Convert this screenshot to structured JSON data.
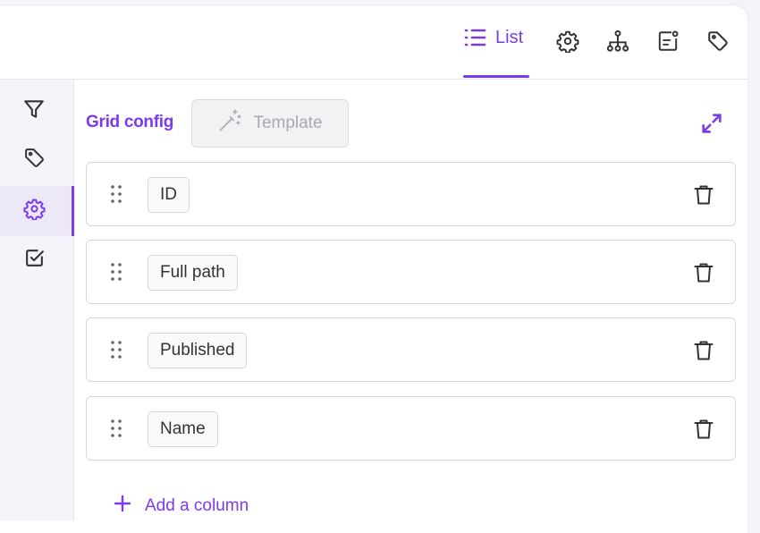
{
  "colors": {
    "accent": "#7c3aed",
    "page_background": "#f4f3f8",
    "icon": "#333333"
  },
  "toolbar": {
    "active_tab": {
      "label": "List",
      "icon": "list-icon"
    },
    "icons": [
      "gear-icon",
      "hierarchy-icon",
      "document-settings-icon",
      "tag-icon"
    ]
  },
  "sidebar": {
    "items": [
      {
        "icon": "filter-icon",
        "active": false
      },
      {
        "icon": "tag-icon",
        "active": false
      },
      {
        "icon": "gear-icon",
        "active": true
      },
      {
        "icon": "checkbox-icon",
        "active": false
      }
    ]
  },
  "main": {
    "title": "Grid config",
    "template_button": {
      "label": "Template",
      "icon": "magic-wand-icon",
      "disabled": true
    },
    "expand_icon": "expand-icon",
    "columns": [
      {
        "label": "ID"
      },
      {
        "label": "Full path"
      },
      {
        "label": "Published"
      },
      {
        "label": "Name"
      }
    ],
    "add_column_label": "Add a column"
  }
}
